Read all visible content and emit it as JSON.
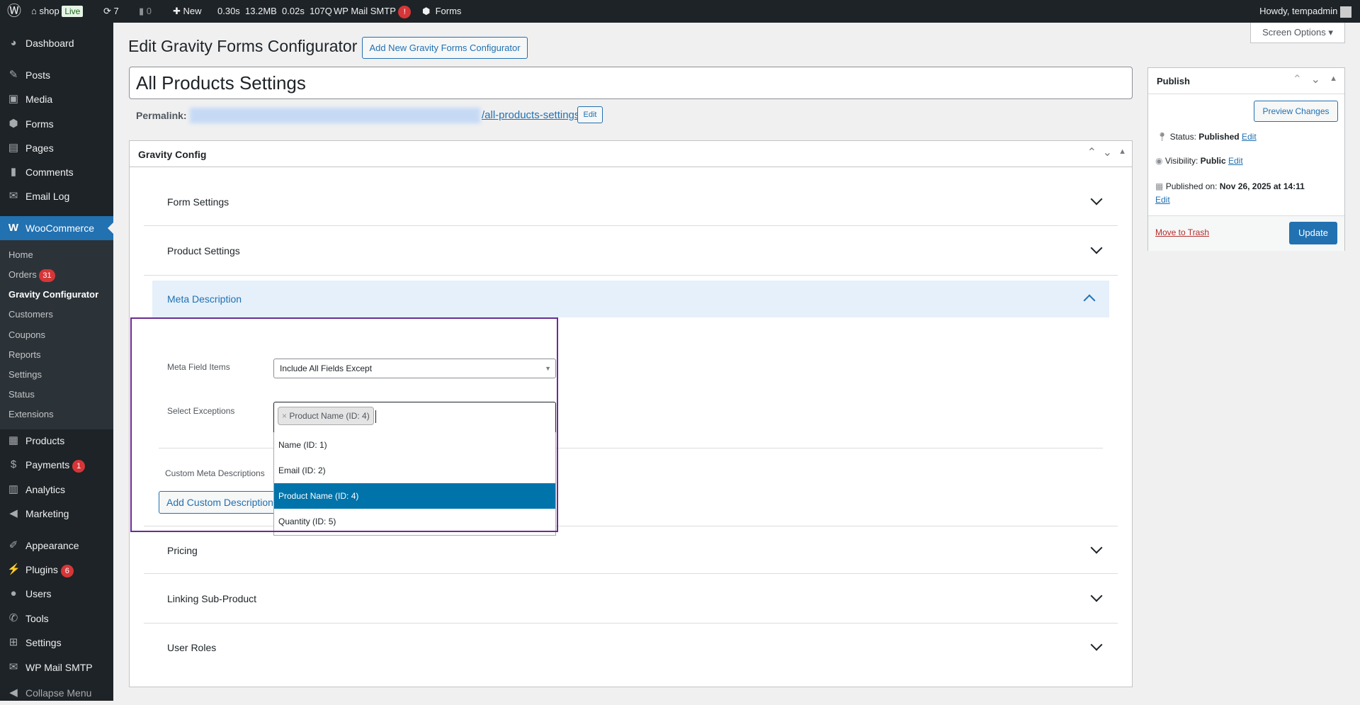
{
  "adminbar": {
    "site": "shop",
    "live": "Live",
    "updates": "7",
    "comments": "0",
    "new": "New",
    "perf": "0.30s  13.2MB  0.02s  107Q",
    "smtp": "WP Mail SMTP",
    "smtp_badge": "!",
    "forms": "Forms",
    "howdy": "Howdy, tempadmin"
  },
  "sidebar": {
    "items": [
      {
        "label": "Dashboard",
        "icon": "dashboard-icon"
      },
      {
        "label": "Posts",
        "icon": "pin-icon"
      },
      {
        "label": "Media",
        "icon": "media-icon"
      },
      {
        "label": "Forms",
        "icon": "forms-icon"
      },
      {
        "label": "Pages",
        "icon": "pages-icon"
      },
      {
        "label": "Comments",
        "icon": "comment-icon"
      },
      {
        "label": "Email Log",
        "icon": "email-icon"
      },
      {
        "label": "WooCommerce",
        "icon": "woo-icon"
      }
    ],
    "woo_sub": [
      {
        "label": "Home"
      },
      {
        "label": "Orders",
        "badge": "31"
      },
      {
        "label": "Gravity Configurator"
      },
      {
        "label": "Customers"
      },
      {
        "label": "Coupons"
      },
      {
        "label": "Reports"
      },
      {
        "label": "Settings"
      },
      {
        "label": "Status"
      },
      {
        "label": "Extensions"
      }
    ],
    "items2": [
      {
        "label": "Products"
      },
      {
        "label": "Payments",
        "badge": "1"
      },
      {
        "label": "Analytics"
      },
      {
        "label": "Marketing"
      },
      {
        "label": "Appearance"
      },
      {
        "label": "Plugins",
        "badge": "6"
      },
      {
        "label": "Users"
      },
      {
        "label": "Tools"
      },
      {
        "label": "Settings"
      },
      {
        "label": "WP Mail SMTP"
      },
      {
        "label": "Collapse Menu"
      }
    ]
  },
  "header": {
    "title": "Edit Gravity Forms Configurator",
    "add_new": "Add New Gravity Forms Configurator",
    "screen_options": "Screen Options ▾"
  },
  "post": {
    "title": "All Products Settings",
    "permalink_label": "Permalink:",
    "permalink_slug": "/all-products-settings/",
    "edit": "Edit"
  },
  "gravity": {
    "title": "Gravity Config",
    "sections": [
      "Form Settings",
      "Product Settings",
      "Meta Description",
      "Pricing",
      "Linking Sub-Product",
      "User Roles"
    ],
    "meta_field_label": "Meta Field Items",
    "meta_field_value": "Include All Fields Except",
    "exceptions_label": "Select Exceptions",
    "selected_tag": "Product Name (ID: 4)",
    "tag_remove": "×",
    "options": [
      "Name (ID: 1)",
      "Email (ID: 2)",
      "Product Name (ID: 4)",
      "Quantity (ID: 5)"
    ],
    "custom_label": "Custom Meta Descriptions",
    "add_custom": "Add Custom Description"
  },
  "publish": {
    "title": "Publish",
    "preview": "Preview Changes",
    "status_label": "Status:",
    "status": "Published",
    "visibility_label": "Visibility:",
    "visibility": "Public",
    "published_label": "Published on:",
    "published": "Nov 26, 2025 at 14:11",
    "edit": "Edit",
    "trash": "Move to Trash",
    "update": "Update"
  }
}
